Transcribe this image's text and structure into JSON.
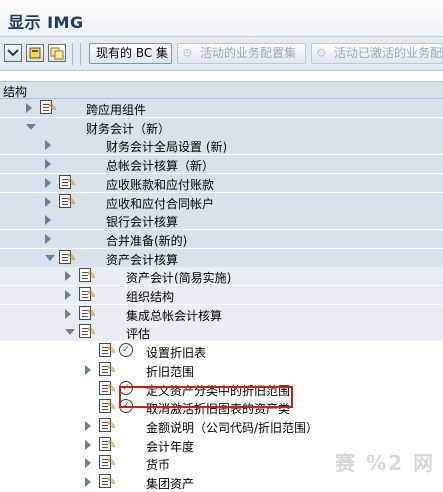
{
  "title": "显示 IMG",
  "toolbar": {
    "icons": [
      "expand-tree-icon",
      "find-icon",
      "layout-icon"
    ],
    "bc_button": "现有的 BC 集",
    "active_button": "活动的业务配置集",
    "activate_button": "活动已激活的业务配"
  },
  "header": {
    "label": "结构"
  },
  "tree": [
    {
      "label": "跨应用组件",
      "level": 0,
      "state": "collapsed",
      "icons": [
        "doc",
        "pen"
      ],
      "bg": "b"
    },
    {
      "label": "财务会计（新）",
      "level": 0,
      "state": "expanded",
      "icons": [],
      "bg": "b"
    },
    {
      "label": "财务会计全局设置 (新)",
      "level": 1,
      "state": "collapsed",
      "icons": [],
      "bg": "b"
    },
    {
      "label": "总帐会计核算（新）",
      "level": 1,
      "state": "collapsed",
      "icons": [],
      "bg": "b"
    },
    {
      "label": "应收账款和应付账款",
      "level": 1,
      "state": "collapsed",
      "icons": [
        "doc",
        "pen"
      ],
      "bg": "b"
    },
    {
      "label": "应收和应付合同帐户",
      "level": 1,
      "state": "collapsed",
      "icons": [
        "doc",
        "pen"
      ],
      "bg": "b"
    },
    {
      "label": "银行会计核算",
      "level": 1,
      "state": "collapsed",
      "icons": [],
      "bg": "b"
    },
    {
      "label": "合并准备(新的)",
      "level": 1,
      "state": "collapsed",
      "icons": [],
      "bg": "b"
    },
    {
      "label": "资产会计核算",
      "level": 1,
      "state": "expanded",
      "icons": [
        "doc",
        "pen"
      ],
      "bg": "b"
    },
    {
      "label": "资产会计(简易实施)",
      "level": 2,
      "state": "collapsed",
      "icons": [
        "doc",
        "pen"
      ],
      "bg": "l"
    },
    {
      "label": "组织结构",
      "level": 2,
      "state": "collapsed",
      "icons": [
        "doc",
        "pen"
      ],
      "bg": "l"
    },
    {
      "label": "集成总帐会计核算",
      "level": 2,
      "state": "collapsed",
      "icons": [
        "doc",
        "pen"
      ],
      "bg": "l"
    },
    {
      "label": "评估",
      "level": 2,
      "state": "expanded",
      "icons": [
        "doc",
        "pen"
      ],
      "bg": "l"
    },
    {
      "label": "设置折旧表",
      "level": 3,
      "state": "leaf",
      "icons": [
        "doc",
        "pen",
        "clock"
      ],
      "bg": "w"
    },
    {
      "label": "折旧范围",
      "level": 3,
      "state": "collapsed",
      "icons": [
        "doc",
        "pen"
      ],
      "bg": "w"
    },
    {
      "label": "定义资产分类中的折旧范围",
      "level": 3,
      "state": "leaf",
      "icons": [
        "doc",
        "pen",
        "clock"
      ],
      "bg": "w"
    },
    {
      "label": "取消激活折旧图表的资产类",
      "level": 3,
      "state": "leaf",
      "icons": [
        "doc",
        "pen",
        "clock"
      ],
      "bg": "w",
      "selected": true
    },
    {
      "label": "金额说明（公司代码/折旧范围）",
      "level": 3,
      "state": "collapsed",
      "icons": [
        "doc",
        "pen"
      ],
      "bg": "w"
    },
    {
      "label": "会计年度",
      "level": 3,
      "state": "collapsed",
      "icons": [
        "doc",
        "pen"
      ],
      "bg": "w"
    },
    {
      "label": "货币",
      "level": 3,
      "state": "collapsed",
      "icons": [
        "doc",
        "pen"
      ],
      "bg": "w"
    },
    {
      "label": "集团资产",
      "level": 3,
      "state": "collapsed",
      "icons": [
        "doc",
        "pen"
      ],
      "bg": "w"
    }
  ],
  "watermark": "赛 %2 网"
}
